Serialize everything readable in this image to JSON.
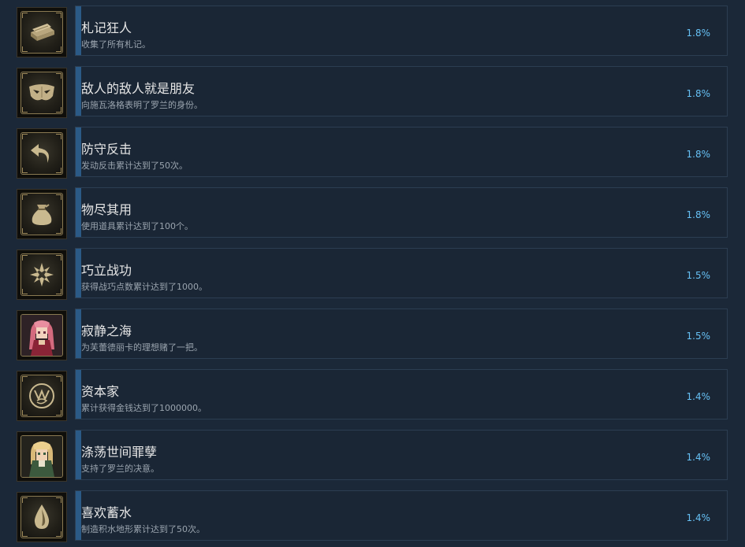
{
  "achievements": [
    {
      "title": "札记狂人",
      "desc": "收集了所有札记。",
      "pct": "1.8%",
      "icon": "book-icon"
    },
    {
      "title": "敌人的敌人就是朋友",
      "desc": "向施瓦洛格表明了罗兰的身份。",
      "pct": "1.8%",
      "icon": "mask-icon"
    },
    {
      "title": "防守反击",
      "desc": "发动反击累计达到了50次。",
      "pct": "1.8%",
      "icon": "counter-arrow-icon"
    },
    {
      "title": "物尽其用",
      "desc": "使用道具累计达到了100个。",
      "pct": "1.8%",
      "icon": "item-bag-icon"
    },
    {
      "title": "巧立战功",
      "desc": "获得战巧点数累计达到了1000。",
      "pct": "1.5%",
      "icon": "star-burst-icon"
    },
    {
      "title": "寂静之海",
      "desc": "为芙蕾德丽卡的理想赌了一把。",
      "pct": "1.5%",
      "icon": "frederica-portrait-icon"
    },
    {
      "title": "资本家",
      "desc": "累计获得金钱达到了1000000。",
      "pct": "1.4%",
      "icon": "coin-icon"
    },
    {
      "title": "涤荡世间罪孽",
      "desc": "支持了罗兰的决意。",
      "pct": "1.4%",
      "icon": "roland-portrait-icon"
    },
    {
      "title": "喜欢蓄水",
      "desc": "制造积水地形累计达到了50次。",
      "pct": "1.4%",
      "icon": "water-drop-icon"
    }
  ]
}
